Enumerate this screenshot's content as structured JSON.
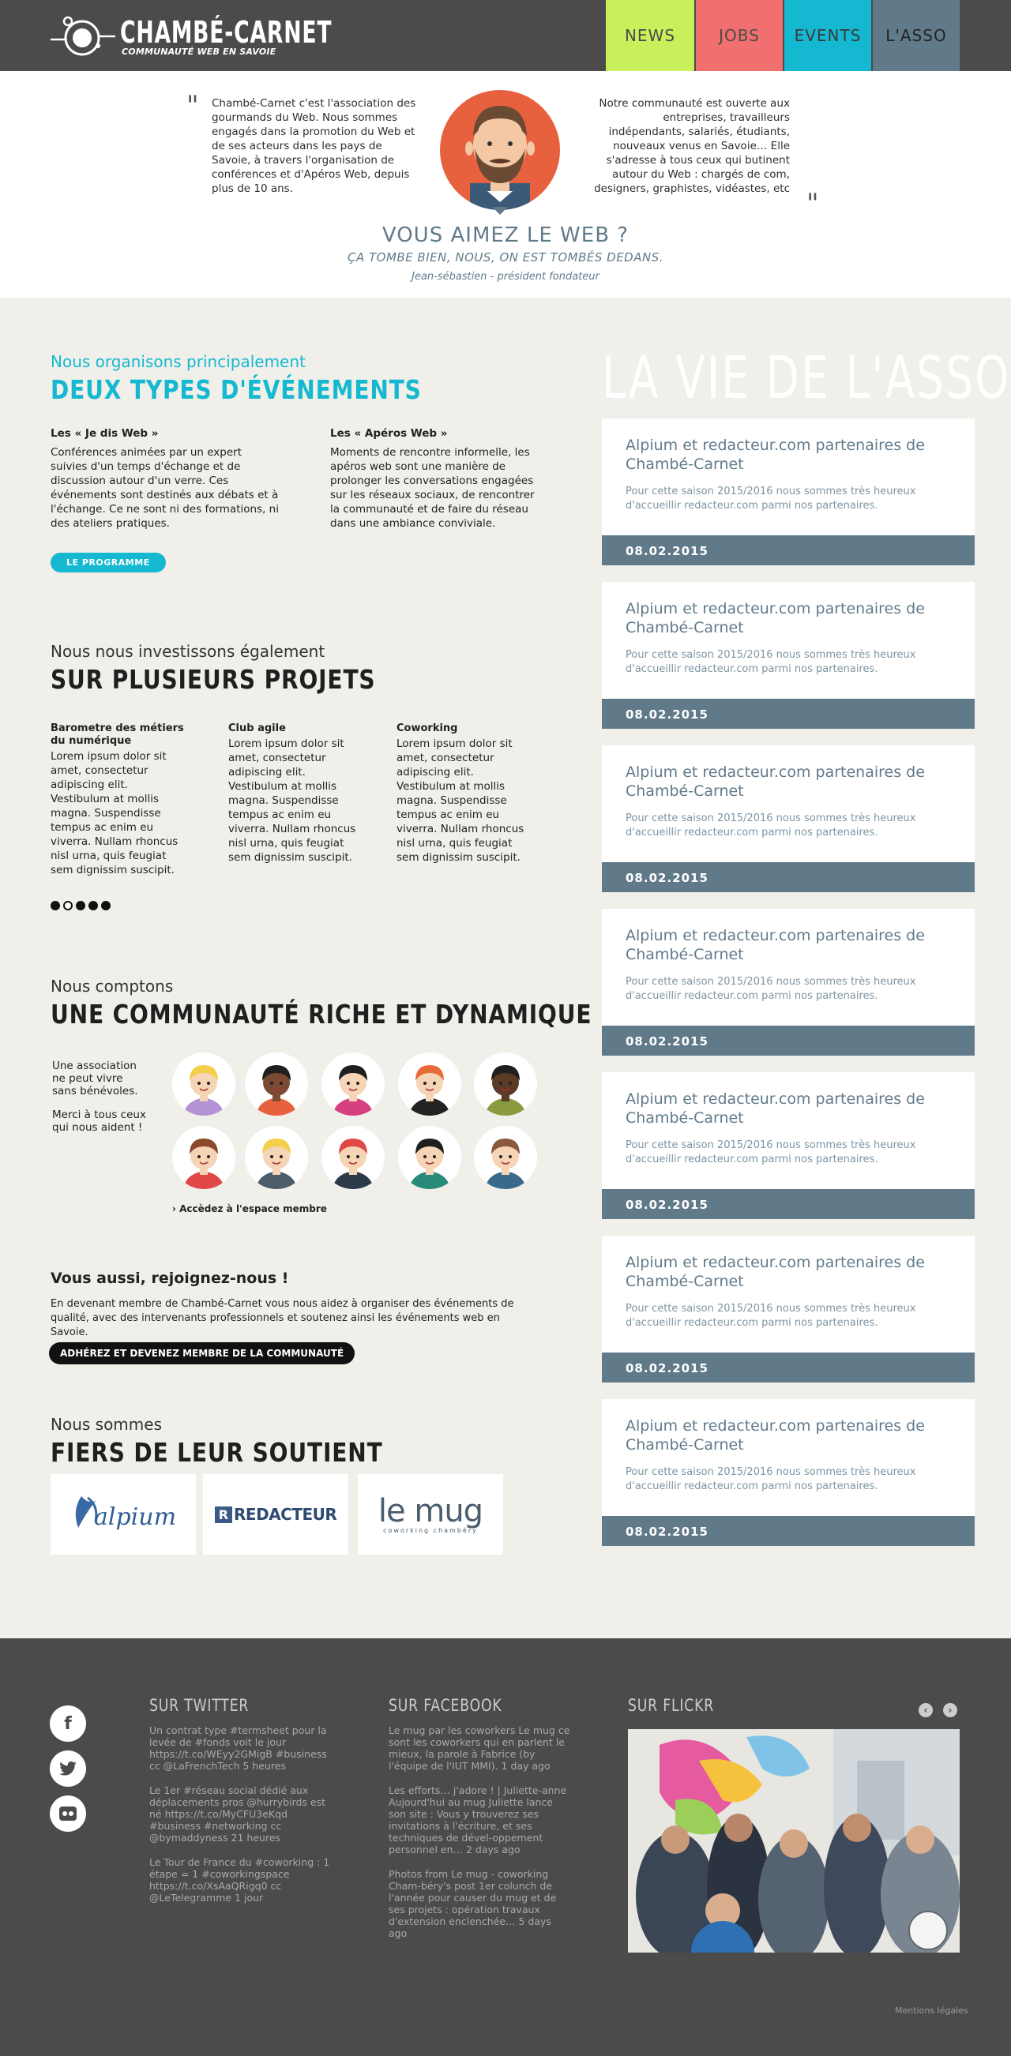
{
  "header": {
    "logo_title": "CHAMBÉ-CARNET",
    "logo_subtitle": "COMMUNAUTÉ WEB EN SAVOIE",
    "nav": [
      "NEWS",
      "JOBS",
      "EVENTS",
      "L'ASSO"
    ]
  },
  "intro": {
    "left_text": "Chambé-Carnet c'est l'association des gourmands du Web. Nous sommes engagés dans la promotion du Web et de ses acteurs dans les pays de Savoie, à travers l'organisation de conférences et d'Apéros Web, depuis plus de 10 ans.",
    "right_text": "Notre communauté est ouverte aux entreprises, travailleurs indépendants, salariés, étudiants, nouveaux venus en Savoie… Elle s'adresse à tous ceux qui butinent autour du Web : chargés de com, designers, graphistes, vidéastes, etc",
    "title": "VOUS AIMEZ LE WEB ?",
    "subtitle": "ÇA TOMBE BIEN, NOUS, ON EST TOMBÉS DEDANS.",
    "author": "Jean-sébastien - président fondateur"
  },
  "events": {
    "small": "Nous organisons principalement",
    "big": "DEUX TYPES D'ÉVÉNEMENTS",
    "col1_title": "Les « Je dis Web »",
    "col1_text": "Conférences animées par un expert suivies d'un temps d'échange et de discussion autour d'un verre. Ces événements sont destinés aux débats et à l'échange. Ce ne sont ni des formations, ni des ateliers pratiques.",
    "col2_title": "Les « Apéros Web »",
    "col2_text": "Moments de rencontre informelle, les apéros web sont une manière de prolonger les conversations engagées sur les réseaux sociaux, de rencontrer la communauté et de faire du réseau dans une ambiance conviviale.",
    "button": "LE PROGRAMME"
  },
  "projects": {
    "small": "Nous nous investissons également",
    "big": "SUR PLUSIEURS PROJETS",
    "items": [
      {
        "title": "Barometre des métiers du numérique",
        "text": "Lorem ipsum dolor sit amet, consectetur adipiscing elit. Vestibulum at mollis magna. Suspendisse tempus ac enim eu viverra. Nullam rhoncus nisl urna, quis feugiat sem dignissim suscipit."
      },
      {
        "title": "Club agile",
        "text": "Lorem ipsum dolor sit amet, consectetur adipiscing elit. Vestibulum at mollis magna. Suspendisse tempus ac enim eu viverra. Nullam rhoncus nisl urna, quis feugiat sem dignissim suscipit."
      },
      {
        "title": "Coworking",
        "text": "Lorem ipsum dolor sit amet, consectetur adipiscing elit. Vestibulum at mollis magna. Suspendisse tempus ac enim eu viverra. Nullam rhoncus nisl urna, quis feugiat sem dignissim suscipit."
      }
    ]
  },
  "community": {
    "small": "Nous comptons",
    "big": "UNE COMMUNAUTÉ RICHE ET DYNAMIQUE",
    "text1": "Une association ne peut vivre sans bénévoles.",
    "text2": "Merci à tous ceux qui nous aident !",
    "link": "› Accèdez à l'espace membre"
  },
  "join": {
    "title": "Vous aussi, rejoignez-nous !",
    "text": "En devenant membre de Chambé-Carnet vous nous aidez à organiser des événements de qualité, avec des intervenants professionnels et soutenez ainsi les événements web en Savoie.",
    "button": "ADHÉREZ ET DEVENEZ MEMBRE DE LA COMMUNAUTÉ"
  },
  "partners": {
    "small": "Nous sommes",
    "big": "FIERS DE LEUR SOUTIENT",
    "logos": [
      "alpium",
      "REDACTEUR",
      "le mug",
      "coworking chambéry"
    ]
  },
  "news": {
    "title": "LA VIE DE L'ASSO",
    "cards": [
      {
        "title": "Alpium et redacteur.com partenaires de Chambé-Carnet",
        "text": "Pour cette saison 2015/2016 nous sommes très heureux d'accueillir redacteur.com parmi nos partenaires.",
        "date": "08.02.2015"
      },
      {
        "title": "Alpium et redacteur.com partenaires de Chambé-Carnet",
        "text": "Pour cette saison 2015/2016 nous sommes très heureux d'accueillir redacteur.com parmi nos partenaires.",
        "date": "08.02.2015"
      },
      {
        "title": "Alpium et redacteur.com partenaires de Chambé-Carnet",
        "text": "Pour cette saison 2015/2016 nous sommes très heureux d'accueillir redacteur.com parmi nos partenaires.",
        "date": "08.02.2015"
      },
      {
        "title": "Alpium et redacteur.com partenaires de Chambé-Carnet",
        "text": "Pour cette saison 2015/2016 nous sommes très heureux d'accueillir redacteur.com parmi nos partenaires.",
        "date": "08.02.2015"
      },
      {
        "title": "Alpium et redacteur.com partenaires de Chambé-Carnet",
        "text": "Pour cette saison 2015/2016 nous sommes très heureux d'accueillir redacteur.com parmi nos partenaires.",
        "date": "08.02.2015"
      },
      {
        "title": "Alpium et redacteur.com partenaires de Chambé-Carnet",
        "text": "Pour cette saison 2015/2016 nous sommes très heureux d'accueillir redacteur.com parmi nos partenaires.",
        "date": "08.02.2015"
      },
      {
        "title": "Alpium et redacteur.com partenaires de Chambé-Carnet",
        "text": "Pour cette saison 2015/2016 nous sommes très heureux d'accueillir redacteur.com parmi nos partenaires.",
        "date": "08.02.2015"
      }
    ]
  },
  "footer": {
    "twitter_title": "SUR TWITTER",
    "facebook_title": "SUR FACEBOOK",
    "flickr_title": "SUR FLICKR",
    "tweets": [
      "Un contrat type #termsheet pour la levée de #fonds voit le jour https://t.co/WEyy2GMigB #business cc @LaFrenchTech           5 heures",
      " Le 1er #réseau social dédié aux déplacements pros @hurrybirds est né https://t.co/MyCFU3eKqd #business #networking cc @bymaddyness 21 heures",
      "Le Tour de France du #coworking : 1 étape = 1 #coworkingspace https://t.co/XsAaQRigq0 cc @LeTelegramme 1 jour"
    ],
    "facebook_posts": [
      "Le mug par les coworkers Le mug ce sont les coworkers qui en parlent le mieux, la parole à Fabrice (by l'équipe de l'IUT MMI). 1 day ago",
      "Les efforts… j'adore ! | Juliette-anne Aujourd'hui au mug Juliette lance son site : Vous y trouverez ses invitations à l'écriture, et ses techniques de dével-oppement personnel en… 2 days ago",
      "Photos from Le mug - coworking Cham-béry's post 1er colunch de l'année pour causer du mug et de ses projets : opération travaux d'extension enclenchée… 5 days ago"
    ],
    "legal": "Mentions légales"
  }
}
